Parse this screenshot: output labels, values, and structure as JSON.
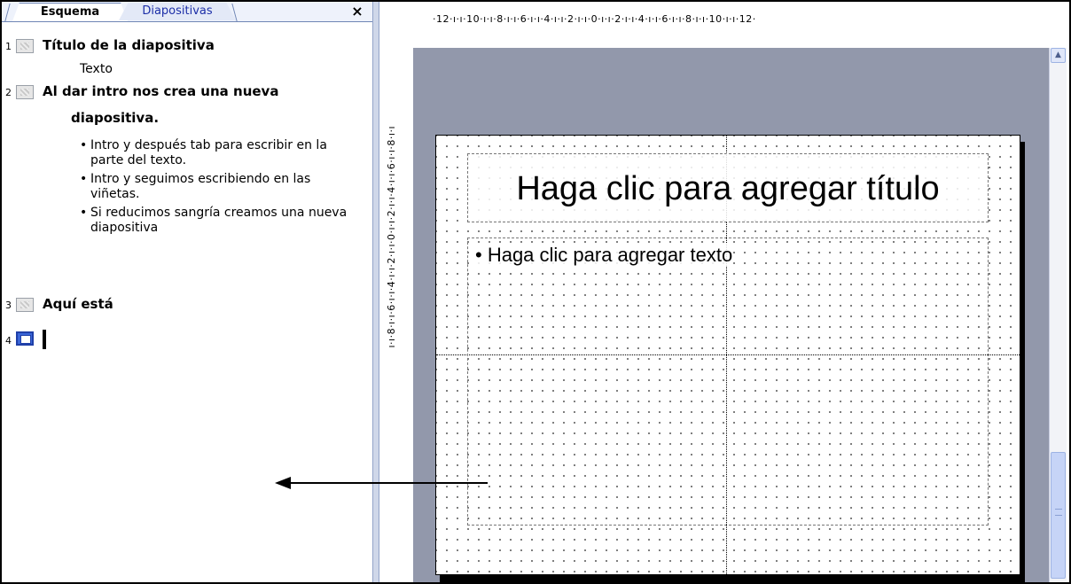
{
  "tabs": {
    "outline_label": "Esquema",
    "slides_label": "Diapositivas",
    "close_label": "×"
  },
  "outline": {
    "slides": [
      {
        "number": "1",
        "title": "Título de la diapositiva",
        "text": "Texto"
      },
      {
        "number": "2",
        "title_line1": "Al dar intro nos crea una nueva",
        "title_line2": "diapositiva.",
        "bullets": [
          "Intro y después tab para escribir en la parte del texto.",
          "Intro y seguimos escribiendo en las viñetas.",
          "Si reducimos sangría creamos una nueva diapositiva"
        ]
      },
      {
        "number": "3",
        "title": "Aquí está"
      },
      {
        "number": "4"
      }
    ],
    "bullet_glyph": "•"
  },
  "rulers": {
    "horizontal": "·12·ı·ı·10·ı·ı·8·ı·ı·6·ı·ı·4·ı·ı·2·ı·ı·0·ı·ı·2·ı·ı·4·ı·ı·6·ı·ı·8·ı·ı·10·ı·ı·12·",
    "vertical": "ı·ı·8·ı·ı·6·ı·ı·4·ı·ı·2·ı·ı·0·ı·ı·2·ı·ı·4·ı·ı·6·ı·ı·8·ı·ı"
  },
  "slide": {
    "title_placeholder": "Haga clic para agregar título",
    "body_placeholder": "• Haga clic para agregar texto"
  },
  "scrollbar": {
    "up_arrow": "▲"
  },
  "colors": {
    "tab_text": "#1d2fa8",
    "canvas": "#9298ab",
    "selected_icon": "#3a66d8"
  }
}
